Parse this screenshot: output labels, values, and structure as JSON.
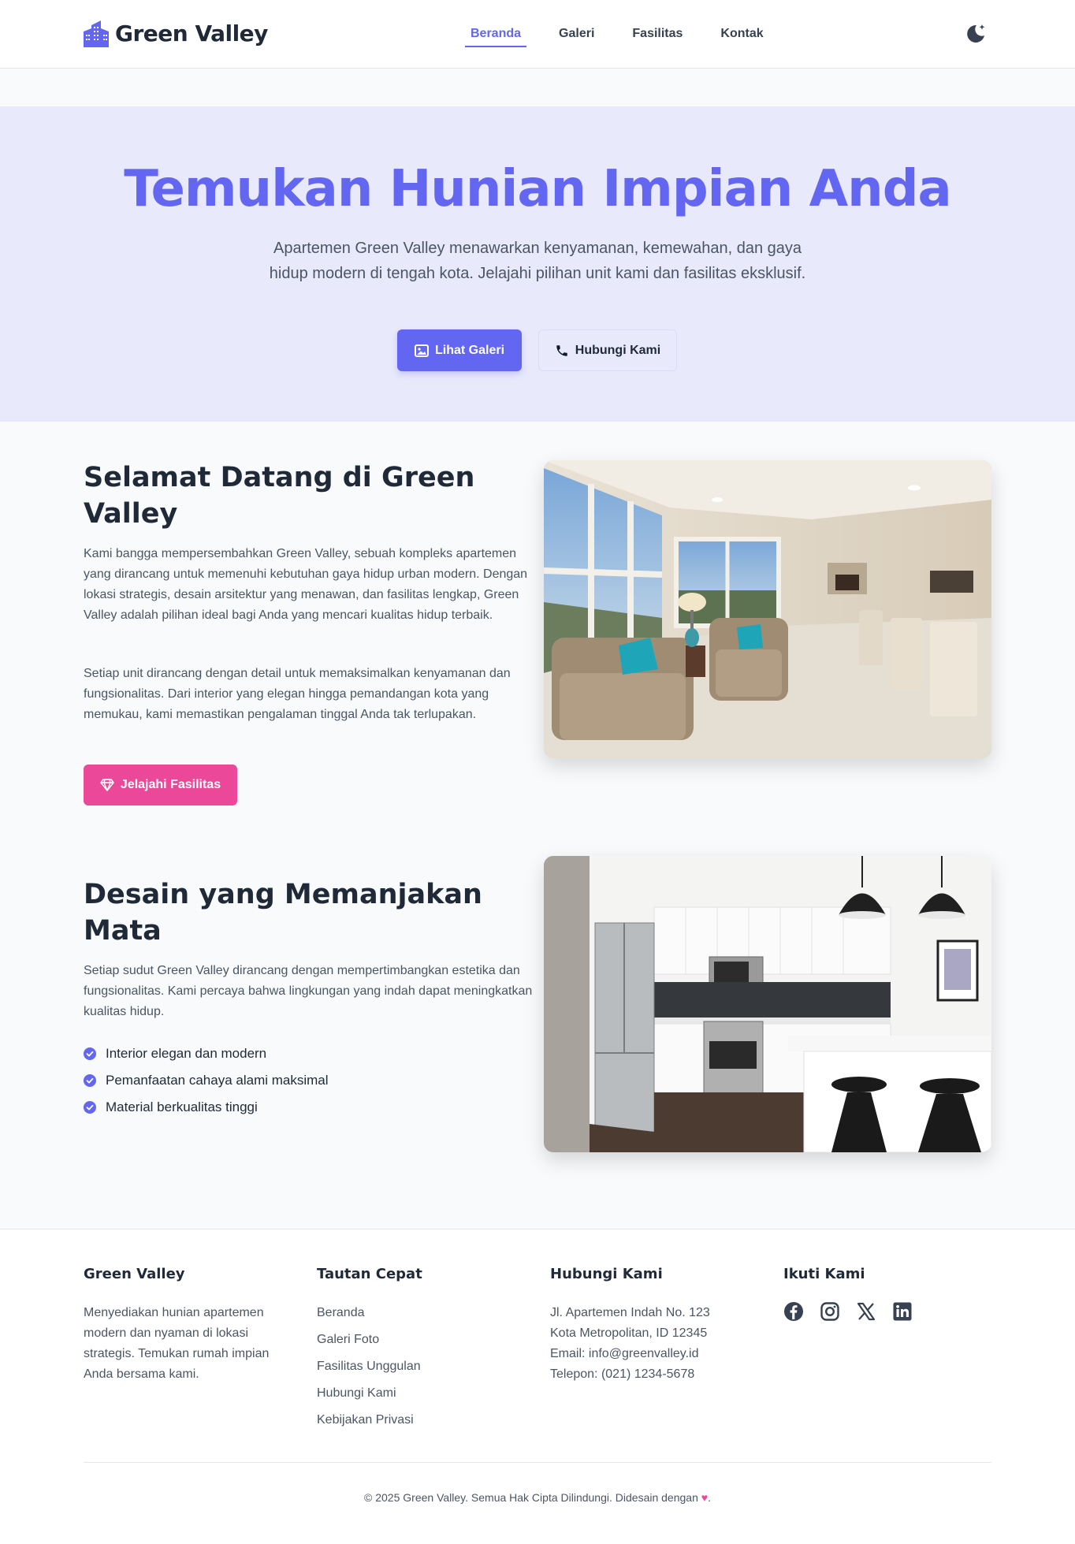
{
  "brand": {
    "name": "Green Valley",
    "logo_icon": "building-icon",
    "accent": "#6366f1",
    "pink": "#ec4899"
  },
  "nav": {
    "items": [
      {
        "label": "Beranda",
        "active": true
      },
      {
        "label": "Galeri"
      },
      {
        "label": "Fasilitas"
      },
      {
        "label": "Kontak"
      }
    ],
    "theme_icon": "moon-icon"
  },
  "hero": {
    "title": "Temukan Hunian Impian Anda",
    "subtitle": "Apartemen Green Valley menawarkan kenyamanan, kemewahan, dan gaya hidup modern di tengah kota. Jelajahi pilihan unit kami dan fasilitas eksklusif.",
    "primary_button": "Lihat Galeri",
    "secondary_button": "Hubungi Kami"
  },
  "welcome": {
    "title": "Selamat Datang di Green Valley",
    "p1": "Kami bangga mempersembahkan Green Valley, sebuah kompleks apartemen yang dirancang untuk memenuhi kebutuhan gaya hidup urban modern. Dengan lokasi strategis, desain arsitektur yang menawan, dan fasilitas lengkap, Green Valley adalah pilihan ideal bagi Anda yang mencari kualitas hidup terbaik.",
    "p2": "Setiap unit dirancang dengan detail untuk memaksimalkan kenyamanan dan fungsionalitas. Dari interior yang elegan hingga pemandangan kota yang memukau, kami memastikan pengalaman tinggal Anda tak terlupakan.",
    "button": "Jelajahi Fasilitas"
  },
  "design": {
    "title": "Desain yang Memanjakan Mata",
    "p": "Setiap sudut Green Valley dirancang dengan mempertimbangkan estetika dan fungsionalitas. Kami percaya bahwa lingkungan yang indah dapat meningkatkan kualitas hidup.",
    "features": [
      "Interior elegan dan modern",
      "Pemanfaatan cahaya alami maksimal",
      "Material berkualitas tinggi"
    ]
  },
  "footer": {
    "about_title": "Green Valley",
    "about_text": "Menyediakan hunian apartemen modern dan nyaman di lokasi strategis. Temukan rumah impian Anda bersama kami.",
    "links_title": "Tautan Cepat",
    "links": [
      "Beranda",
      "Galeri Foto",
      "Fasilitas Unggulan",
      "Hubungi Kami",
      "Kebijakan Privasi"
    ],
    "contact_title": "Hubungi Kami",
    "address1": "Jl. Apartemen Indah No. 123",
    "address2": "Kota Metropolitan, ID 12345",
    "email": "Email: info@greenvalley.id",
    "phone": "Telepon: (021) 1234-5678",
    "social_title": "Ikuti Kami",
    "social": [
      "facebook-icon",
      "instagram-icon",
      "x-icon",
      "linkedin-icon"
    ],
    "copyright_pre": "© 2025 Green Valley. Semua Hak Cipta Dilindungi. Didesain dengan",
    "copyright_post": "."
  }
}
